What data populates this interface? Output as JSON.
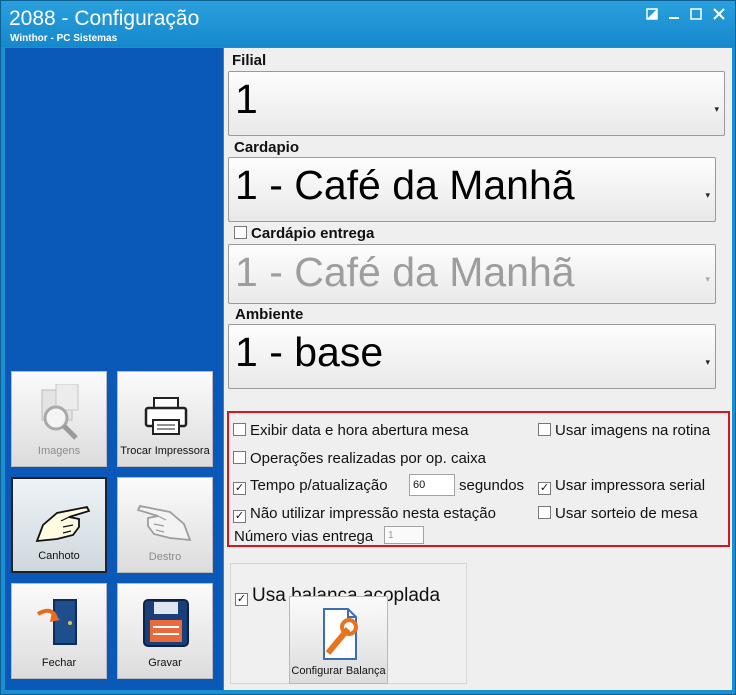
{
  "window": {
    "title": "2088 - Configuração",
    "subtitle": "Winthor - PC Sistemas"
  },
  "sidebar": {
    "buttons": [
      {
        "label": "Imagens",
        "icon": "images-icon",
        "enabled": false
      },
      {
        "label": "Trocar Impressora",
        "icon": "printer-icon",
        "enabled": true
      },
      {
        "label": "Canhoto",
        "icon": "left-hand-icon",
        "enabled": true,
        "selected": true
      },
      {
        "label": "Destro",
        "icon": "right-hand-icon",
        "enabled": false
      },
      {
        "label": "Fechar",
        "icon": "exit-door-icon",
        "enabled": true
      },
      {
        "label": "Gravar",
        "icon": "floppy-disk-icon",
        "enabled": true
      }
    ]
  },
  "form": {
    "filial": {
      "label": "Filial",
      "value": "1"
    },
    "cardapio": {
      "label": "Cardapio",
      "value": "1 - Café da Manhã"
    },
    "cardapio_entrega": {
      "label": "Cardápio entrega",
      "value": "1 - Café da Manhã",
      "checked": false
    },
    "ambiente": {
      "label": "Ambiente",
      "value": "1 - base"
    }
  },
  "options": {
    "exibir_data": {
      "label": "Exibir data e hora abertura mesa",
      "checked": false
    },
    "usar_imagens": {
      "label": "Usar imagens na rotina",
      "checked": false
    },
    "operacoes": {
      "label": "Operações realizadas por op. caixa",
      "checked": false
    },
    "tempo": {
      "label": "Tempo p/atualização",
      "checked": true,
      "value": "60",
      "unit": "segundos"
    },
    "impressora_serial": {
      "label": "Usar impressora serial",
      "checked": true
    },
    "nao_utilizar": {
      "label": "Não utilizar impressão nesta estação",
      "checked": true
    },
    "sorteio": {
      "label": "Usar sorteio de mesa",
      "checked": false
    },
    "numero_vias": {
      "label": "Número vias entrega",
      "value": "1"
    }
  },
  "balanca": {
    "label": "Usa balança acoplada",
    "checked": true,
    "button_label": "Configurar Balança"
  },
  "colors": {
    "titlebar": "#1b8fd1",
    "sidebar": "#0a58b7",
    "highlight_border": "#d8141d"
  }
}
